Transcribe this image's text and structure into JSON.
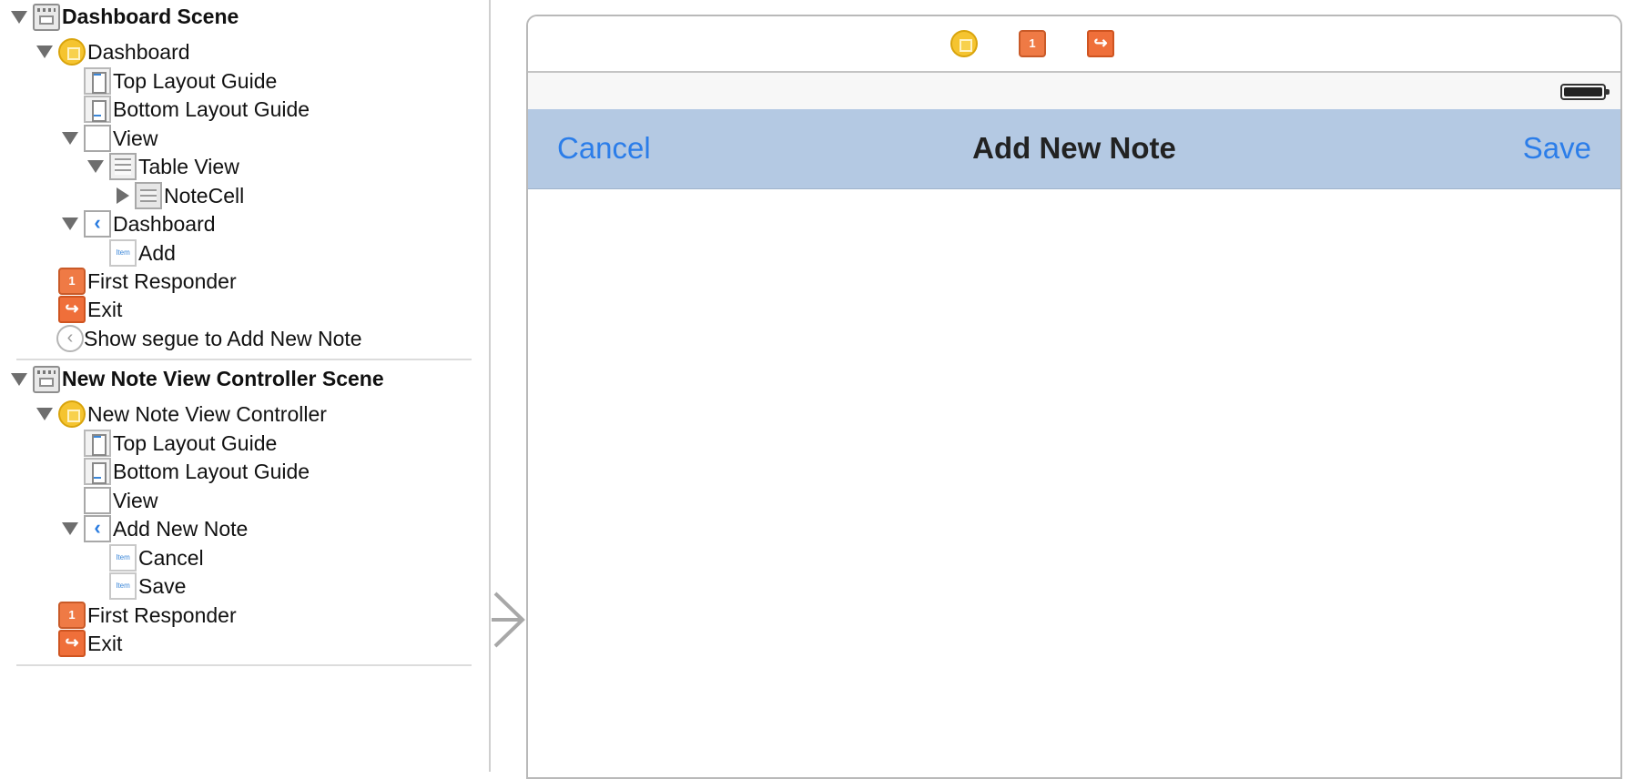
{
  "outline": {
    "scenes": [
      {
        "title": "Dashboard Scene",
        "items": [
          {
            "label": "Dashboard",
            "icon": "view-controller-icon"
          },
          {
            "label": "Top Layout Guide",
            "icon": "top-layout-guide-icon"
          },
          {
            "label": "Bottom Layout Guide",
            "icon": "bottom-layout-guide-icon"
          },
          {
            "label": "View",
            "icon": "view-icon"
          },
          {
            "label": "Table View",
            "icon": "table-view-icon"
          },
          {
            "label": "NoteCell",
            "icon": "table-cell-icon"
          },
          {
            "label": "Dashboard",
            "icon": "navigation-item-icon"
          },
          {
            "label": "Add",
            "icon": "bar-button-item-icon"
          },
          {
            "label": "First Responder",
            "icon": "first-responder-icon"
          },
          {
            "label": "Exit",
            "icon": "exit-icon"
          },
          {
            "label": "Show segue to Add New Note",
            "icon": "segue-icon"
          }
        ]
      },
      {
        "title": "New Note View Controller Scene",
        "items": [
          {
            "label": "New Note View Controller",
            "icon": "view-controller-icon"
          },
          {
            "label": "Top Layout Guide",
            "icon": "top-layout-guide-icon"
          },
          {
            "label": "Bottom Layout Guide",
            "icon": "bottom-layout-guide-icon"
          },
          {
            "label": "View",
            "icon": "view-icon"
          },
          {
            "label": "Add New Note",
            "icon": "navigation-item-icon"
          },
          {
            "label": "Cancel",
            "icon": "bar-button-item-icon"
          },
          {
            "label": "Save",
            "icon": "bar-button-item-icon"
          },
          {
            "label": "First Responder",
            "icon": "first-responder-icon"
          },
          {
            "label": "Exit",
            "icon": "exit-icon"
          }
        ]
      }
    ],
    "item_badge": "Item",
    "first_responder_badge": "1"
  },
  "canvas": {
    "nav_bar": {
      "left_button": "Cancel",
      "title": "Add New Note",
      "right_button": "Save"
    },
    "dock_icons": [
      "view-controller-icon",
      "first-responder-icon",
      "exit-icon"
    ]
  },
  "colors": {
    "nav_bar_bg": "#b4c9e3",
    "tint": "#2b7de9",
    "status_bar_bg": "#f7f7f7",
    "first_responder": "#ef7a45",
    "view_controller": "#f5c430"
  }
}
